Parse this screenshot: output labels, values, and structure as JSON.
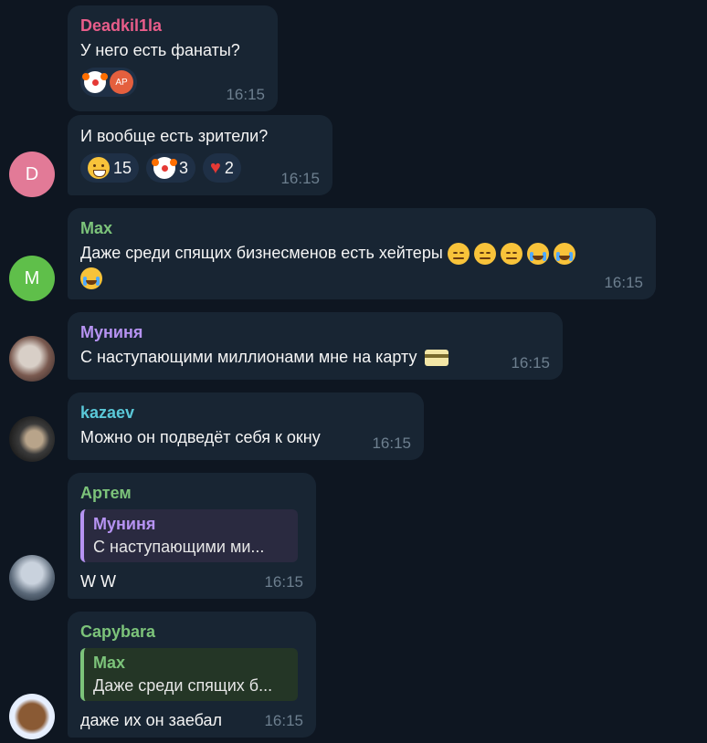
{
  "messages": [
    {
      "author": "Deadkil1la",
      "author_color": "#e85d8a",
      "text": "У него есть фанаты?",
      "time": "16:15",
      "reaction_avatar": "AP"
    },
    {
      "text": "И вообще есть зрители?",
      "time": "16:15",
      "avatar_letter": "D",
      "avatar_color": "#e27a97",
      "reactions": [
        {
          "icon": "grin-emoji",
          "count": "15"
        },
        {
          "icon": "clown-emoji",
          "count": "3"
        },
        {
          "icon": "heart-emoji",
          "count": "2"
        }
      ]
    },
    {
      "author": "Max",
      "author_color": "#7cc37a",
      "text": "Даже среди спящих бизнесменов есть хейтеры",
      "time": "16:15",
      "avatar_letter": "M",
      "avatar_color": "#5fbf4a"
    },
    {
      "author": "Муниня",
      "author_color": "#b693f2",
      "text": "С наступающими миллионами мне на карту",
      "time": "16:15"
    },
    {
      "author": "kazaev",
      "author_color": "#5ac8d8",
      "text": "Можно он подведёт себя к окну",
      "time": "16:15"
    },
    {
      "author": "Артем",
      "author_color": "#7cc37a",
      "reply_author": "Муниня",
      "reply_color": "#b693f2",
      "reply_text": "С наступающими ми...",
      "text": "W W",
      "time": "16:15"
    },
    {
      "author": "Capybara",
      "author_color": "#7cc37a",
      "reply_author": "Max",
      "reply_color": "#7cc37a",
      "reply_text": "Даже среди спящих б...",
      "text": "даже их он заебал",
      "time": "16:15"
    }
  ]
}
